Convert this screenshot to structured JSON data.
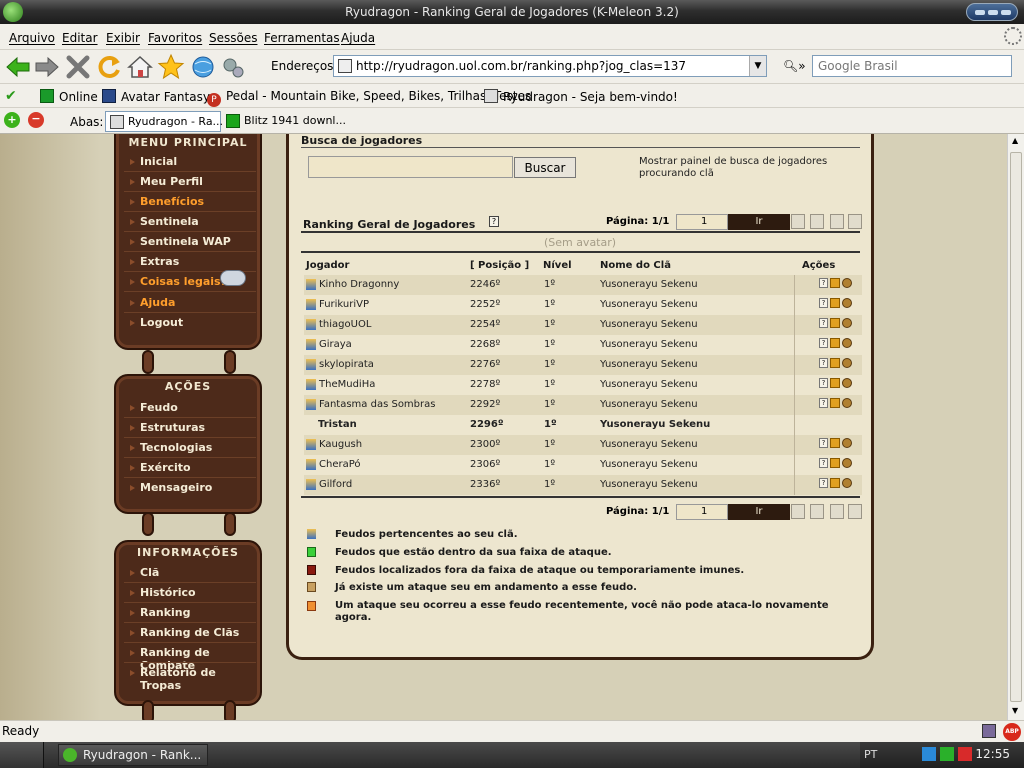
{
  "window": {
    "title": "Ryudragon - Ranking Geral de Jogadores (K-Meleon 3.2)"
  },
  "menu": [
    "Arquivo",
    "Editar",
    "Exibir",
    "Favoritos",
    "Sessões",
    "Ferramentas",
    "Ajuda"
  ],
  "nav": {
    "address_label": "Endereços:",
    "url": "http://ryudragon.uol.com.br/ranking.php?jog_clas=137",
    "search_placeholder": "Google Brasil"
  },
  "bookmarks": [
    "Online",
    "Avatar Fantasy",
    "Pedal - Mountain Bike, Speed, Bikes, Trilhas, Testes",
    "Ryudragon - Seja bem-vindo!"
  ],
  "tabs": {
    "label": "Abas:",
    "items": [
      "Ryudragon - Ra...",
      "Blitz 1941 downl..."
    ]
  },
  "sidebar": {
    "menu_principal": {
      "title": "MENU PRINCIPAL",
      "items": [
        "Inicial",
        "Meu Perfil",
        "Benefícios",
        "Sentinela",
        "Sentinela WAP",
        "Extras",
        "Coisas legais!",
        "Ajuda",
        "Logout"
      ]
    },
    "acoes": {
      "title": "AÇÕES",
      "items": [
        "Feudo",
        "Estruturas",
        "Tecnologias",
        "Exército",
        "Mensageiro"
      ]
    },
    "informacoes": {
      "title": "INFORMAÇÕES",
      "items": [
        "Clã",
        "Histórico",
        "Ranking",
        "Ranking de Clãs",
        "Ranking de Combate",
        "Relatório de Tropas"
      ]
    }
  },
  "search": {
    "title": "Busca de jogadores",
    "button": "Buscar",
    "hint": "Mostrar painel de busca de jogadores procurando clã"
  },
  "ranking": {
    "title": "Ranking Geral de Jogadores",
    "help": "?",
    "page_label": "Página: 1/1",
    "page_value": "1",
    "go": "Ir",
    "no_avatar": "(Sem avatar)",
    "columns": [
      "Jogador",
      "[ Posição ]",
      "Nível",
      "Nome do Clã",
      "Ações"
    ],
    "rows": [
      {
        "player": "Kinho Dragonny",
        "pos": "2246º",
        "level": "1º",
        "clan": "Yusonerayu Sekenu"
      },
      {
        "player": "FurikuriVP",
        "pos": "2252º",
        "level": "1º",
        "clan": "Yusonerayu Sekenu"
      },
      {
        "player": "thiagoUOL",
        "pos": "2254º",
        "level": "1º",
        "clan": "Yusonerayu Sekenu"
      },
      {
        "player": "Giraya",
        "pos": "2268º",
        "level": "1º",
        "clan": "Yusonerayu Sekenu"
      },
      {
        "player": "skylopirata",
        "pos": "2276º",
        "level": "1º",
        "clan": "Yusonerayu Sekenu"
      },
      {
        "player": "TheMudiHa",
        "pos": "2278º",
        "level": "1º",
        "clan": "Yusonerayu Sekenu"
      },
      {
        "player": "Fantasma das Sombras",
        "pos": "2292º",
        "level": "1º",
        "clan": "Yusonerayu Sekenu"
      },
      {
        "player": "Tristan",
        "pos": "2296º",
        "level": "1º",
        "clan": "Yusonerayu Sekenu"
      },
      {
        "player": "Kaugush",
        "pos": "2300º",
        "level": "1º",
        "clan": "Yusonerayu Sekenu"
      },
      {
        "player": "CheraPó",
        "pos": "2306º",
        "level": "1º",
        "clan": "Yusonerayu Sekenu"
      },
      {
        "player": "Gilford",
        "pos": "2336º",
        "level": "1º",
        "clan": "Yusonerayu Sekenu"
      }
    ]
  },
  "legend": [
    "Feudos pertencentes ao seu clã.",
    "Feudos que estão dentro da sua faixa de ataque.",
    "Feudos localizados fora da faixa de ataque ou temporariamente imunes.",
    "Já existe um ataque seu em andamento a esse feudo.",
    "Um ataque seu ocorreu a esse feudo recentemente, você não pode ataca-lo novamente agora."
  ],
  "status": {
    "text": "Ready"
  },
  "taskbar": {
    "task": "Ryudragon - Rank...",
    "lang": "PT",
    "clock": "12:55"
  }
}
